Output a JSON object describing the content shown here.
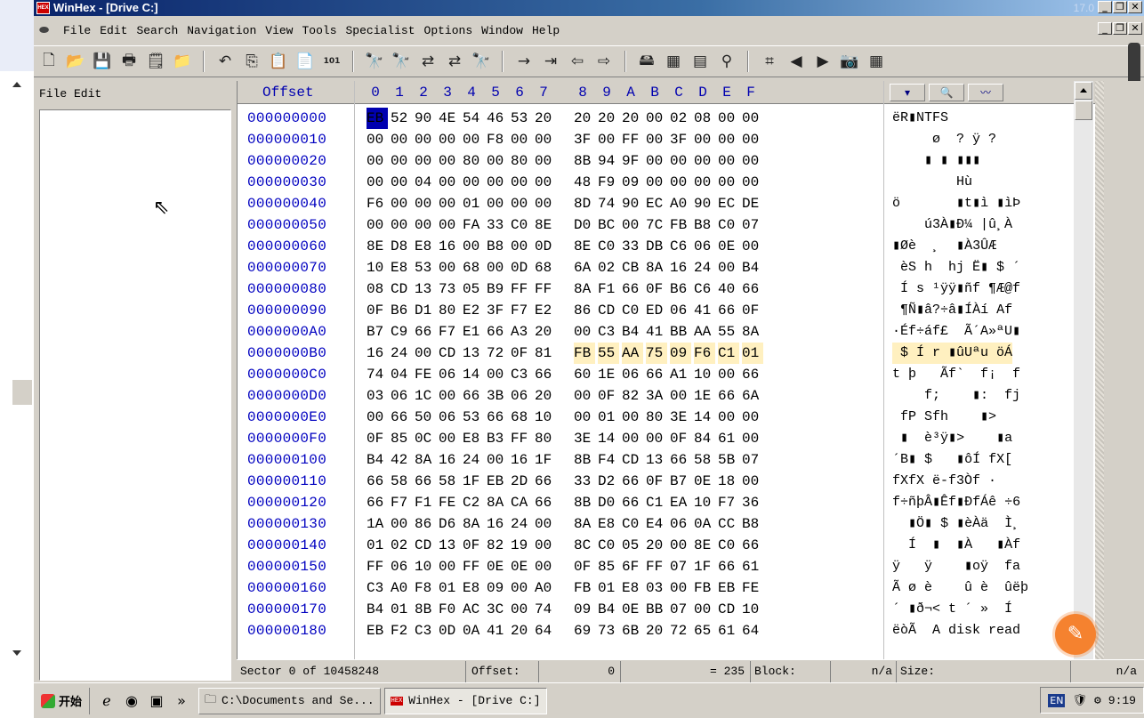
{
  "title": {
    "text": "WinHex - [Drive C:]",
    "version": "17.0",
    "icon_label": "HEX"
  },
  "menu": [
    "File",
    "Edit",
    "Search",
    "Navigation",
    "View",
    "Tools",
    "Specialist",
    "Options",
    "Window",
    "Help"
  ],
  "file_panel": {
    "header": "File Edit"
  },
  "hex_header": {
    "offset_title": "Offset",
    "columns": [
      "0",
      "1",
      "2",
      "3",
      "4",
      "5",
      "6",
      "7",
      "8",
      "9",
      "A",
      "B",
      "C",
      "D",
      "E",
      "F"
    ]
  },
  "rows": [
    {
      "off": "000000000",
      "bytes": [
        "EB",
        "52",
        "90",
        "4E",
        "54",
        "46",
        "53",
        "20",
        "20",
        "20",
        "20",
        "00",
        "02",
        "08",
        "00",
        "00"
      ],
      "text": "ëR▮NTFS"
    },
    {
      "off": "000000010",
      "bytes": [
        "00",
        "00",
        "00",
        "00",
        "00",
        "F8",
        "00",
        "00",
        "3F",
        "00",
        "FF",
        "00",
        "3F",
        "00",
        "00",
        "00"
      ],
      "text": "     ø  ? ÿ ?"
    },
    {
      "off": "000000020",
      "bytes": [
        "00",
        "00",
        "00",
        "00",
        "80",
        "00",
        "80",
        "00",
        "8B",
        "94",
        "9F",
        "00",
        "00",
        "00",
        "00",
        "00"
      ],
      "text": "    ▮ ▮ ▮▮▮"
    },
    {
      "off": "000000030",
      "bytes": [
        "00",
        "00",
        "04",
        "00",
        "00",
        "00",
        "00",
        "00",
        "48",
        "F9",
        "09",
        "00",
        "00",
        "00",
        "00",
        "00"
      ],
      "text": "        Hù"
    },
    {
      "off": "000000040",
      "bytes": [
        "F6",
        "00",
        "00",
        "00",
        "01",
        "00",
        "00",
        "00",
        "8D",
        "74",
        "90",
        "EC",
        "A0",
        "90",
        "EC",
        "DE"
      ],
      "text": "ö       ▮t▮ì ▮ìÞ"
    },
    {
      "off": "000000050",
      "bytes": [
        "00",
        "00",
        "00",
        "00",
        "FA",
        "33",
        "C0",
        "8E",
        "D0",
        "BC",
        "00",
        "7C",
        "FB",
        "B8",
        "C0",
        "07"
      ],
      "text": "    ú3À▮Ð¼ |û¸À"
    },
    {
      "off": "000000060",
      "bytes": [
        "8E",
        "D8",
        "E8",
        "16",
        "00",
        "B8",
        "00",
        "0D",
        "8E",
        "C0",
        "33",
        "DB",
        "C6",
        "06",
        "0E",
        "00"
      ],
      "text": "▮Øè  ¸  ▮À3ÛÆ"
    },
    {
      "off": "000000070",
      "bytes": [
        "10",
        "E8",
        "53",
        "00",
        "68",
        "00",
        "0D",
        "68",
        "6A",
        "02",
        "CB",
        "8A",
        "16",
        "24",
        "00",
        "B4"
      ],
      "text": " èS h  hj Ë▮ $ ´"
    },
    {
      "off": "000000080",
      "bytes": [
        "08",
        "CD",
        "13",
        "73",
        "05",
        "B9",
        "FF",
        "FF",
        "8A",
        "F1",
        "66",
        "0F",
        "B6",
        "C6",
        "40",
        "66"
      ],
      "text": " Í s ¹ÿÿ▮ñf ¶Æ@f"
    },
    {
      "off": "000000090",
      "bytes": [
        "0F",
        "B6",
        "D1",
        "80",
        "E2",
        "3F",
        "F7",
        "E2",
        "86",
        "CD",
        "C0",
        "ED",
        "06",
        "41",
        "66",
        "0F"
      ],
      "text": " ¶Ñ▮â?÷â▮ÍÀí Af"
    },
    {
      "off": "0000000A0",
      "bytes": [
        "B7",
        "C9",
        "66",
        "F7",
        "E1",
        "66",
        "A3",
        "20",
        "00",
        "C3",
        "B4",
        "41",
        "BB",
        "AA",
        "55",
        "8A"
      ],
      "text": "·Éf÷áf£  Ã´A»ªU▮"
    },
    {
      "off": "0000000B0",
      "bytes": [
        "16",
        "24",
        "00",
        "CD",
        "13",
        "72",
        "0F",
        "81",
        "FB",
        "55",
        "AA",
        "75",
        "09",
        "F6",
        "C1",
        "01"
      ],
      "text": " $ Í r ▮ûUªu öÁ"
    },
    {
      "off": "0000000C0",
      "bytes": [
        "74",
        "04",
        "FE",
        "06",
        "14",
        "00",
        "C3",
        "66",
        "60",
        "1E",
        "06",
        "66",
        "A1",
        "10",
        "00",
        "66"
      ],
      "text": "t þ   Ãf`  f¡  f"
    },
    {
      "off": "0000000D0",
      "bytes": [
        "03",
        "06",
        "1C",
        "00",
        "66",
        "3B",
        "06",
        "20",
        "00",
        "0F",
        "82",
        "3A",
        "00",
        "1E",
        "66",
        "6A"
      ],
      "text": "    f;    ▮:  fj"
    },
    {
      "off": "0000000E0",
      "bytes": [
        "00",
        "66",
        "50",
        "06",
        "53",
        "66",
        "68",
        "10",
        "00",
        "01",
        "00",
        "80",
        "3E",
        "14",
        "00",
        "00"
      ],
      "text": " fP Sfh    ▮>"
    },
    {
      "off": "0000000F0",
      "bytes": [
        "0F",
        "85",
        "0C",
        "00",
        "E8",
        "B3",
        "FF",
        "80",
        "3E",
        "14",
        "00",
        "00",
        "0F",
        "84",
        "61",
        "00"
      ],
      "text": " ▮  è³ÿ▮>    ▮a"
    },
    {
      "off": "000000100",
      "bytes": [
        "B4",
        "42",
        "8A",
        "16",
        "24",
        "00",
        "16",
        "1F",
        "8B",
        "F4",
        "CD",
        "13",
        "66",
        "58",
        "5B",
        "07"
      ],
      "text": "´B▮ $   ▮ôÍ fX["
    },
    {
      "off": "000000110",
      "bytes": [
        "66",
        "58",
        "66",
        "58",
        "1F",
        "EB",
        "2D",
        "66",
        "33",
        "D2",
        "66",
        "0F",
        "B7",
        "0E",
        "18",
        "00"
      ],
      "text": "fXfX ë-f3Òf ·"
    },
    {
      "off": "000000120",
      "bytes": [
        "66",
        "F7",
        "F1",
        "FE",
        "C2",
        "8A",
        "CA",
        "66",
        "8B",
        "D0",
        "66",
        "C1",
        "EA",
        "10",
        "F7",
        "36"
      ],
      "text": "f÷ñþÂ▮Êf▮ÐfÁê ÷6"
    },
    {
      "off": "000000130",
      "bytes": [
        "1A",
        "00",
        "86",
        "D6",
        "8A",
        "16",
        "24",
        "00",
        "8A",
        "E8",
        "C0",
        "E4",
        "06",
        "0A",
        "CC",
        "B8"
      ],
      "text": "  ▮Ö▮ $ ▮èÀä  Ì¸"
    },
    {
      "off": "000000140",
      "bytes": [
        "01",
        "02",
        "CD",
        "13",
        "0F",
        "82",
        "19",
        "00",
        "8C",
        "C0",
        "05",
        "20",
        "00",
        "8E",
        "C0",
        "66"
      ],
      "text": "  Í  ▮  ▮À   ▮Àf"
    },
    {
      "off": "000000150",
      "bytes": [
        "FF",
        "06",
        "10",
        "00",
        "FF",
        "0E",
        "0E",
        "00",
        "0F",
        "85",
        "6F",
        "FF",
        "07",
        "1F",
        "66",
        "61"
      ],
      "text": "ÿ   ÿ    ▮oÿ  fa"
    },
    {
      "off": "000000160",
      "bytes": [
        "C3",
        "A0",
        "F8",
        "01",
        "E8",
        "09",
        "00",
        "A0",
        "FB",
        "01",
        "E8",
        "03",
        "00",
        "FB",
        "EB",
        "FE"
      ],
      "text": "Ã ø è    û è  ûëþ"
    },
    {
      "off": "000000170",
      "bytes": [
        "B4",
        "01",
        "8B",
        "F0",
        "AC",
        "3C",
        "00",
        "74",
        "09",
        "B4",
        "0E",
        "BB",
        "07",
        "00",
        "CD",
        "10"
      ],
      "text": "´ ▮ð¬< t ´ »  Í"
    },
    {
      "off": "000000180",
      "bytes": [
        "EB",
        "F2",
        "C3",
        "0D",
        "0A",
        "41",
        "20",
        "64",
        "69",
        "73",
        "6B",
        "20",
        "72",
        "65",
        "61",
        "64"
      ],
      "text": "ëòÃ  A disk read"
    }
  ],
  "status": {
    "sector": "Sector 0 of 10458248",
    "offset_label": "Offset:",
    "offset_value": "0",
    "eq_value": "= 235",
    "block_label": "Block:",
    "block_value": "n/a",
    "size_label": "Size:",
    "size_value": "n/a"
  },
  "taskbar": {
    "start_label": "开始",
    "more": "»",
    "tasks": [
      "C:\\Documents and Se...",
      "WinHex - [Drive C:]"
    ],
    "lang": "EN",
    "time": "9:19"
  },
  "colors": {
    "offset_blue": "#0000c0",
    "highlight": "#fff0c0",
    "title_gradient_start": "#0a246a"
  }
}
